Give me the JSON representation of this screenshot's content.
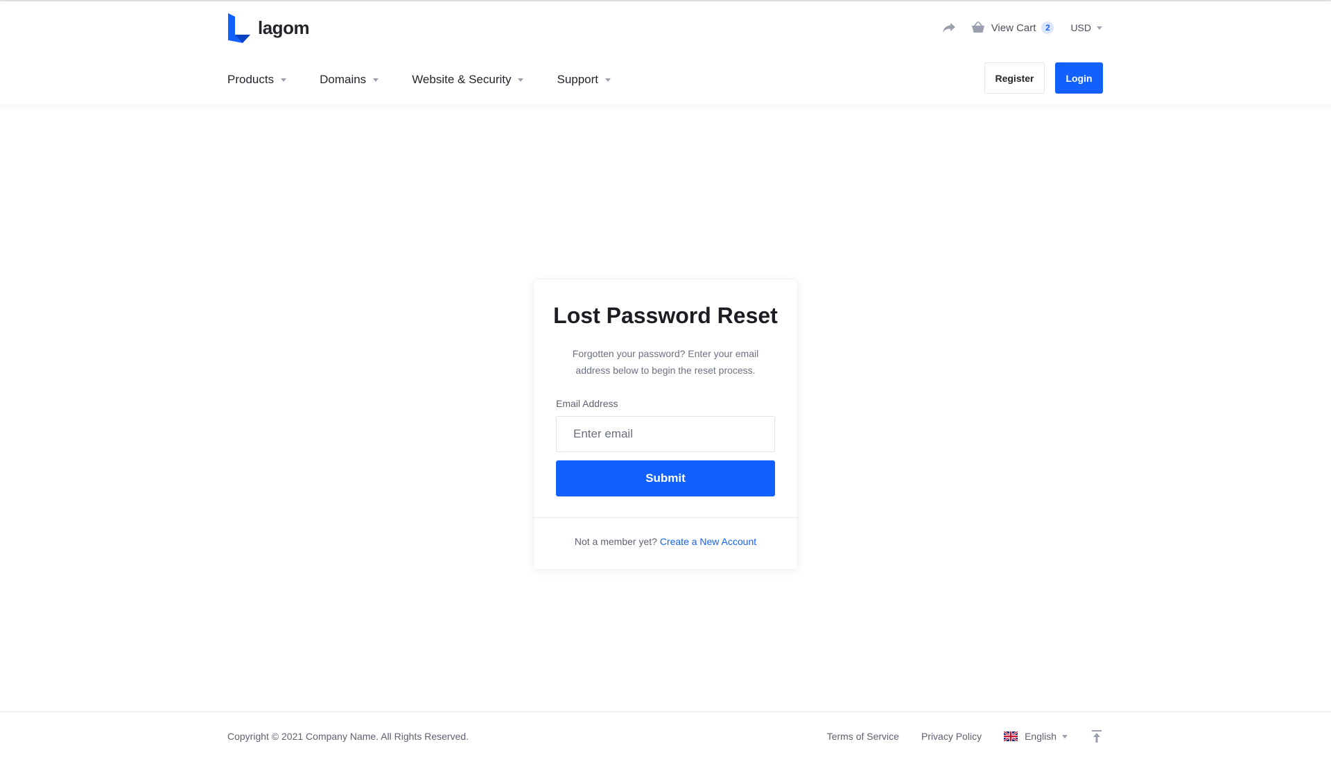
{
  "brand": {
    "name": "lagom",
    "accent": "#1160ff"
  },
  "header": {
    "share_icon": "share-arrow-icon",
    "cart_icon": "basket-icon",
    "cart_label": "View Cart",
    "cart_count": "2",
    "currency": "USD",
    "nav": [
      {
        "label": "Products"
      },
      {
        "label": "Domains"
      },
      {
        "label": "Website & Security"
      },
      {
        "label": "Support"
      }
    ],
    "register_label": "Register",
    "login_label": "Login"
  },
  "card": {
    "title": "Lost Password Reset",
    "description": "Forgotten your password? Enter your email address below to begin the reset process.",
    "email_label": "Email Address",
    "email_placeholder": "Enter email",
    "email_value": "",
    "submit_label": "Submit",
    "footer_prefix": "Not a member yet?",
    "footer_link": "Create a New Account"
  },
  "footer": {
    "copyright": "Copyright © 2021 Company Name. All Rights Reserved.",
    "terms": "Terms of Service",
    "privacy": "Privacy Policy",
    "language": "English",
    "language_flag": "uk-flag-icon",
    "to_top_icon": "arrow-up-icon"
  }
}
